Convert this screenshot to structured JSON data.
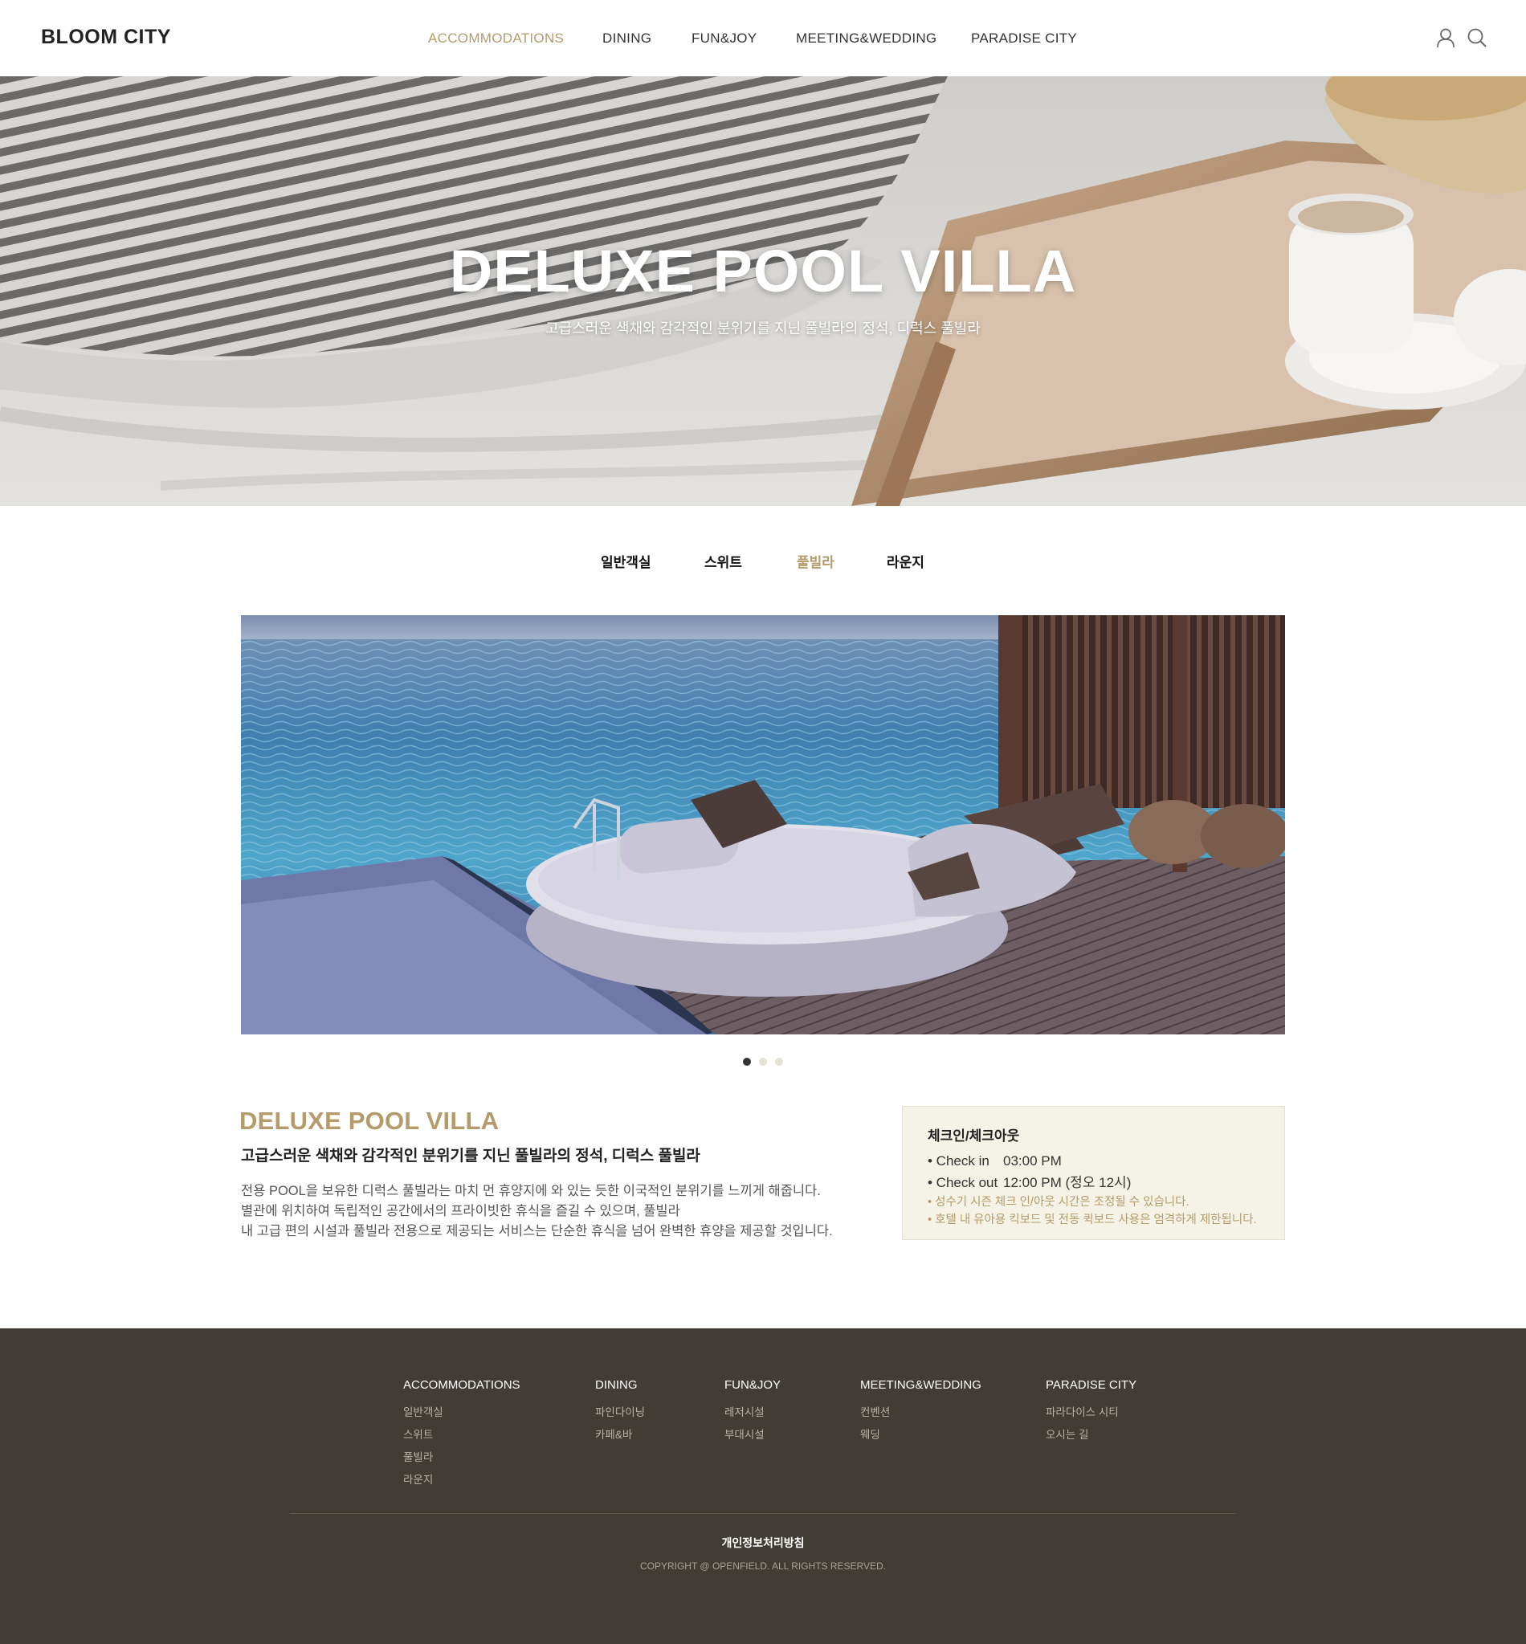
{
  "header": {
    "logo": "BLOOM CITY",
    "nav": [
      "ACCOMMODATIONS",
      "DINING",
      "FUN&JOY",
      "MEETING&WEDDING",
      "PARADISE CITY"
    ],
    "active_nav": "ACCOMMODATIONS",
    "icons": [
      "user-icon",
      "search-icon"
    ]
  },
  "hero": {
    "title": "DELUXE POOL VILLA",
    "subtitle": "고급스러운 색채와 감각적인 분위기를 지닌 풀빌라의 정석, 디럭스 풀빌라"
  },
  "tabs": [
    "일반객실",
    "스위트",
    "풀빌라",
    "라운지"
  ],
  "active_tab": "풀빌라",
  "slider": {
    "slide_count": 3,
    "active_index": 0
  },
  "info": {
    "title": "DELUXE POOL VILLA",
    "subtitle": "고급스러운 색채와 감각적인 분위기를 지닌 풀빌라의 정석, 디럭스 풀빌라",
    "desc": [
      "전용 POOL을 보유한 디럭스 풀빌라는 마치 먼 휴양지에 와 있는 듯한 이국적인 분위기를 느끼게 해줍니다.",
      "별관에 위치하여 독립적인 공간에서의 프라이빗한 휴식을 즐길 수 있으며, 풀빌라",
      "내 고급 편의 시설과 풀빌라 전용으로 제공되는 서비스는 단순한 휴식을 넘어 완벽한 휴양을 제공할 것입니다."
    ]
  },
  "checkin": {
    "title": "체크인/체크아웃",
    "rows": [
      {
        "label": "• Check in",
        "value": "03:00 PM"
      },
      {
        "label": "•  Check out",
        "value": "12:00 PM (정오 12시)"
      }
    ],
    "notes": [
      "• 성수기 시즌 체크 인/아웃 시간은 조정될 수 있습니다.",
      "• 호텔 내 유아용 킥보드 및 전동 퀵보드 사용은 엄격하게 제한됩니다."
    ]
  },
  "footer": {
    "columns": [
      {
        "title": "ACCOMMODATIONS",
        "items": [
          "일반객실",
          "스위트",
          "풀빌라",
          "라운지"
        ]
      },
      {
        "title": "DINING",
        "items": [
          "파인다이닝",
          "카페&바"
        ]
      },
      {
        "title": "FUN&JOY",
        "items": [
          "레저시설",
          "부대시설"
        ]
      },
      {
        "title": "MEETING&WEDDING",
        "items": [
          "컨벤션",
          "웨딩"
        ]
      },
      {
        "title": "PARADISE CITY",
        "items": [
          "파라다이스 시티",
          "오시는 길"
        ]
      }
    ],
    "privacy": "개인정보처리방침",
    "copyright": "COPYRIGHT @ OPENFIELD. ALL RIGHTS RESERVED."
  },
  "colors": {
    "accent": "#b59b6b",
    "footer_bg": "#423c36",
    "panel_bg": "#f5f2e6"
  }
}
